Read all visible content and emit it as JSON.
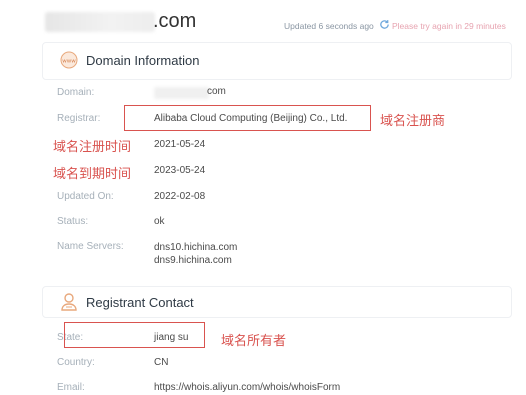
{
  "header": {
    "domain_suffix": ".com",
    "updated_text": "Updated 6 seconds ago",
    "retry_text": "Please try again in 29 minutes",
    "retry_color": "#e7a3b0"
  },
  "domain_info": {
    "title": "Domain Information",
    "icon": "www-globe-icon",
    "rows": {
      "domain": {
        "label": "Domain:",
        "value_suffix": "com"
      },
      "registrar": {
        "label": "Registrar:",
        "value": "Alibaba Cloud Computing (Beijing) Co., Ltd."
      },
      "registered": {
        "value": "2021-05-24"
      },
      "expires": {
        "value": "2023-05-24"
      },
      "updated": {
        "label": "Updated On:",
        "value": "2022-02-08"
      },
      "status": {
        "label": "Status:",
        "value": "ok"
      },
      "name_servers": {
        "label": "Name Servers:",
        "values": [
          "dns10.hichina.com",
          "dns9.hichina.com"
        ]
      }
    }
  },
  "registrant": {
    "title": "Registrant Contact",
    "icon": "person-icon",
    "rows": {
      "state": {
        "label": "State:",
        "value": "jiang su"
      },
      "country": {
        "label": "Country:",
        "value": "CN"
      },
      "email": {
        "label": "Email:",
        "value": "https://whois.aliyun.com/whois/whoisForm"
      }
    }
  },
  "annotations": {
    "registrar": "域名注册商",
    "registration_time": "域名注册时间",
    "expiration_time": "域名到期时间",
    "owner": "域名所有者",
    "color": "#d9534f"
  }
}
